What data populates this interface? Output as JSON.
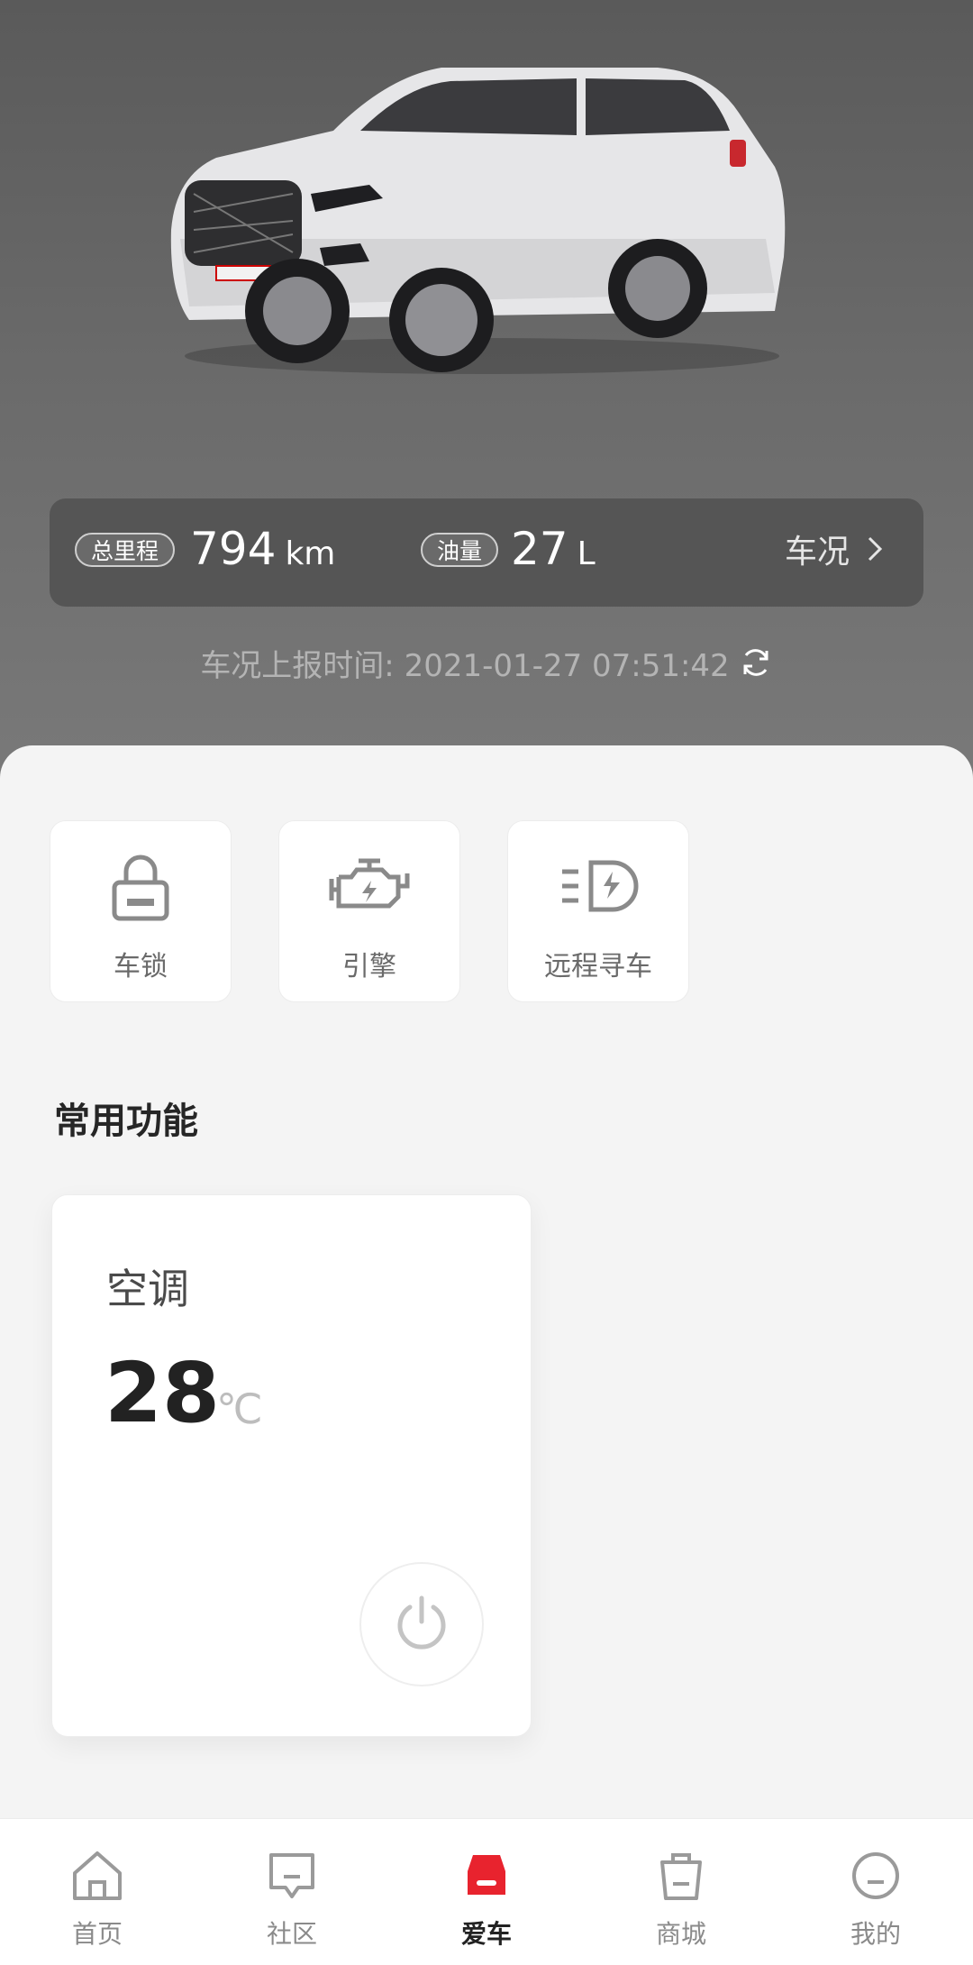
{
  "hero": {
    "car_image": "white-suv-photo",
    "mileage": {
      "label": "总里程",
      "value": "794",
      "unit": "km"
    },
    "fuel": {
      "label": "油量",
      "value": "27",
      "unit": "L"
    },
    "status_link": "车况",
    "report_time": "车况上报时间: 2021-01-27 07:51:42"
  },
  "quick_actions": [
    {
      "label": "车锁",
      "icon": "lock-icon"
    },
    {
      "label": "引擎",
      "icon": "engine-icon"
    },
    {
      "label": "远程寻车",
      "icon": "headlight-icon"
    }
  ],
  "common": {
    "title": "常用功能",
    "ac": {
      "title": "空调",
      "temp": "28",
      "unit": "℃",
      "power_icon": "power-icon"
    }
  },
  "tabbar": [
    {
      "label": "首页",
      "icon": "home-icon"
    },
    {
      "label": "社区",
      "icon": "community-icon"
    },
    {
      "label": "爱车",
      "icon": "car-icon",
      "active": true
    },
    {
      "label": "商城",
      "icon": "shop-icon"
    },
    {
      "label": "我的",
      "icon": "profile-icon"
    }
  ],
  "colors": {
    "accent": "#e8232e",
    "hero_bg": "#666666"
  }
}
